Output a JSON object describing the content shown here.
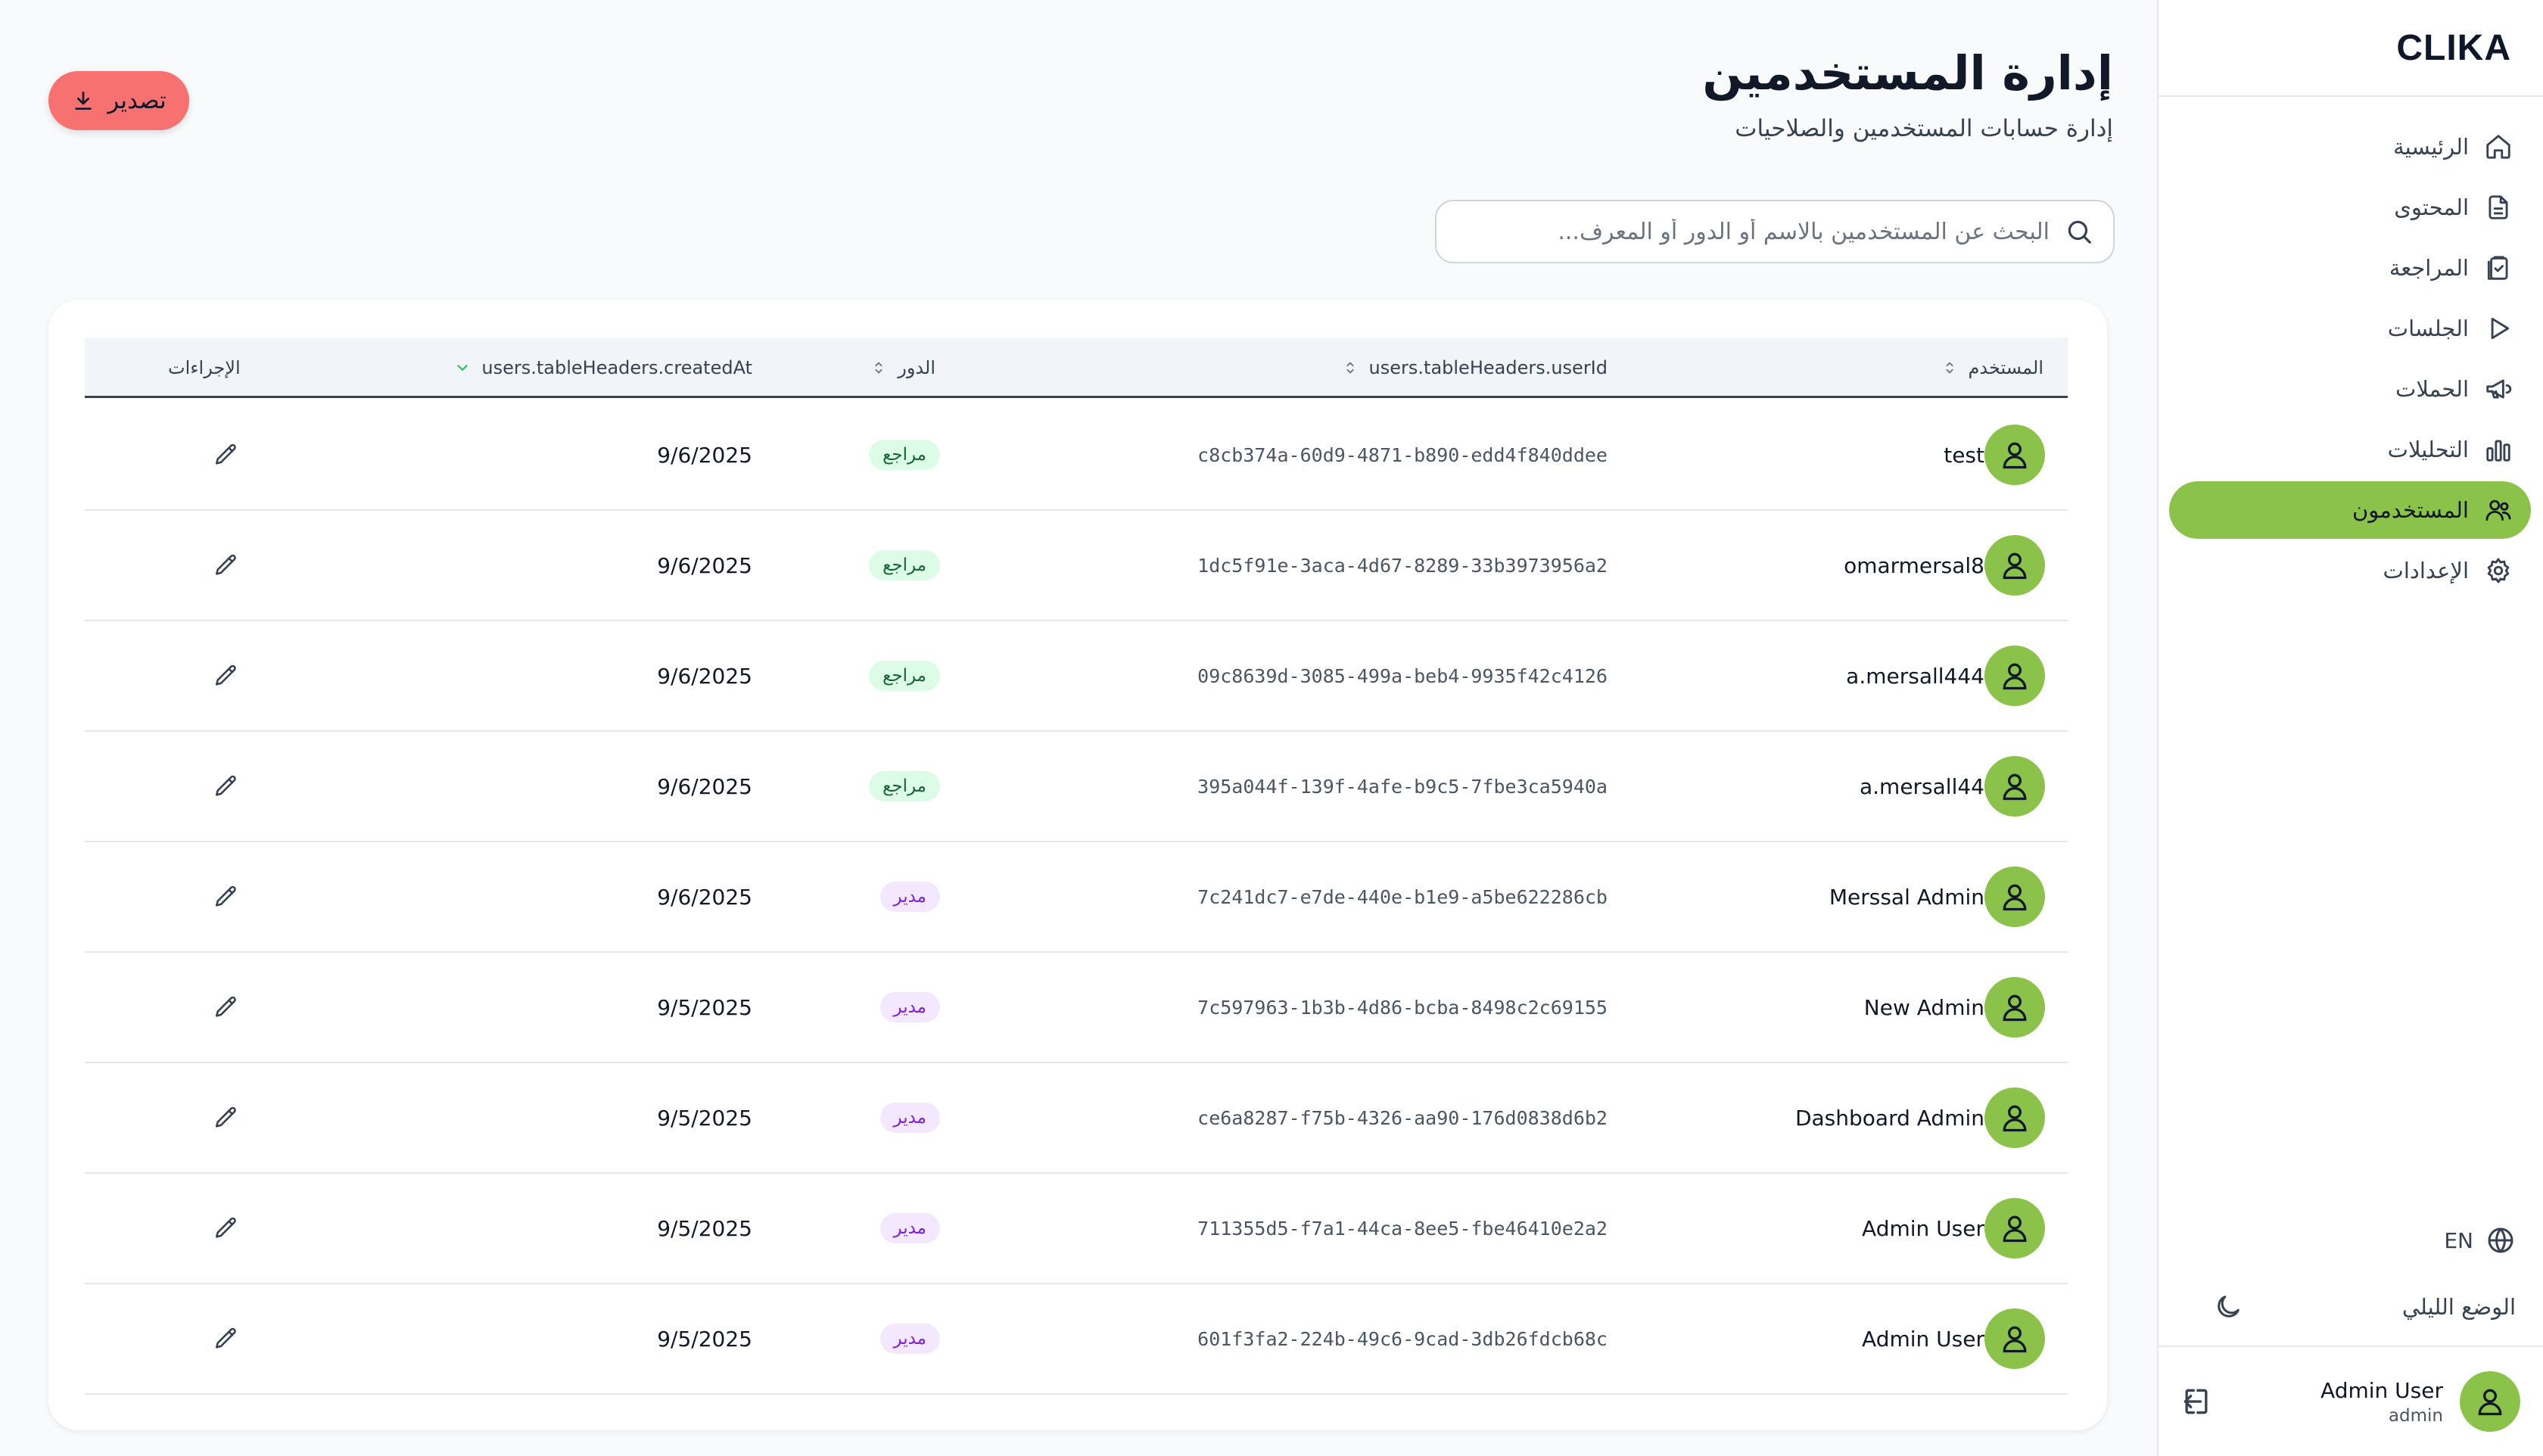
{
  "brand": "CLIKA",
  "sidebar": {
    "items": [
      {
        "label": "الرئيسية",
        "icon": "home-icon",
        "active": false
      },
      {
        "label": "المحتوى",
        "icon": "document-icon",
        "active": false
      },
      {
        "label": "المراجعة",
        "icon": "clipboard-check-icon",
        "active": false
      },
      {
        "label": "الجلسات",
        "icon": "play-icon",
        "active": false
      },
      {
        "label": "الحملات",
        "icon": "megaphone-icon",
        "active": false
      },
      {
        "label": "التحليلات",
        "icon": "bar-chart-icon",
        "active": false
      },
      {
        "label": "المستخدمون",
        "icon": "users-icon",
        "active": true
      },
      {
        "label": "الإعدادات",
        "icon": "settings-icon",
        "active": false
      }
    ],
    "language": "EN",
    "theme_label": "الوضع الليلي",
    "user": {
      "name": "Admin User",
      "role": "admin"
    },
    "accent": "#8bc34a"
  },
  "header": {
    "title": "إدارة المستخدمين",
    "subtitle": "إدارة حسابات المستخدمين والصلاحيات",
    "export_label": "تصدير",
    "export_color": "#f87171"
  },
  "search": {
    "placeholder": "البحث عن المستخدمين بالاسم أو الدور أو المعرف...",
    "value": ""
  },
  "table": {
    "headers": {
      "user": "المستخدم",
      "user_id": "users.tableHeaders.userId",
      "role": "الدور",
      "created_at": "users.tableHeaders.createdAt",
      "actions": "الإجراءات"
    },
    "rows": [
      {
        "name": "test",
        "id": "c8cb374a-60d9-4871-b890-edd4f840ddee",
        "role": "مراجع",
        "role_type": "reviewer",
        "date": "9/6/2025"
      },
      {
        "name": "omarmersal8",
        "id": "1dc5f91e-3aca-4d67-8289-33b3973956a2",
        "role": "مراجع",
        "role_type": "reviewer",
        "date": "9/6/2025"
      },
      {
        "name": "a.mersall444",
        "id": "09c8639d-3085-499a-beb4-9935f42c4126",
        "role": "مراجع",
        "role_type": "reviewer",
        "date": "9/6/2025"
      },
      {
        "name": "a.mersall44",
        "id": "395a044f-139f-4afe-b9c5-7fbe3ca5940a",
        "role": "مراجع",
        "role_type": "reviewer",
        "date": "9/6/2025"
      },
      {
        "name": "Merssal Admin",
        "id": "7c241dc7-e7de-440e-b1e9-a5be622286cb",
        "role": "مدير",
        "role_type": "admin",
        "date": "9/6/2025"
      },
      {
        "name": "New Admin",
        "id": "7c597963-1b3b-4d86-bcba-8498c2c69155",
        "role": "مدير",
        "role_type": "admin",
        "date": "9/5/2025"
      },
      {
        "name": "Dashboard Admin",
        "id": "ce6a8287-f75b-4326-aa90-176d0838d6b2",
        "role": "مدير",
        "role_type": "admin",
        "date": "9/5/2025"
      },
      {
        "name": "Admin User",
        "id": "711355d5-f7a1-44ca-8ee5-fbe46410e2a2",
        "role": "مدير",
        "role_type": "admin",
        "date": "9/5/2025"
      },
      {
        "name": "Admin User",
        "id": "601f3fa2-224b-49c6-9cad-3db26fdcb68c",
        "role": "مدير",
        "role_type": "admin",
        "date": "9/5/2025"
      }
    ]
  }
}
